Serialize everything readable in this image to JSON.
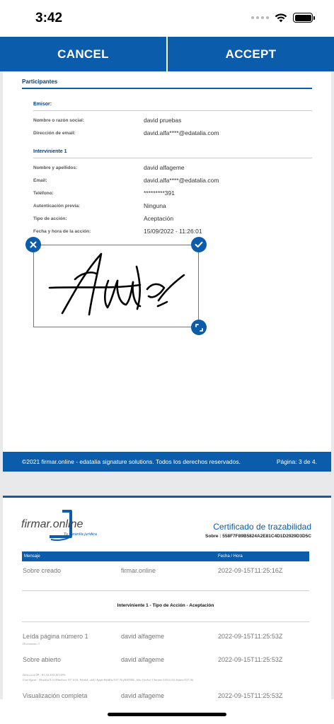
{
  "status": {
    "time": "3:42"
  },
  "actions": {
    "cancel": "CANCEL",
    "accept": "ACCEPT"
  },
  "page1": {
    "section_title": "Participantes",
    "emisor": {
      "title": "Emisor:",
      "rows": [
        {
          "k": "Nombre o razón social:",
          "v": "david pruebas"
        },
        {
          "k": "Dirección de email:",
          "v": "david.alfa****@edatalia.com"
        }
      ]
    },
    "interviniente": {
      "title": "Interviniente 1",
      "rows": [
        {
          "k": "Nombre y apellidos:",
          "v": "david alfageme"
        },
        {
          "k": "Email:",
          "v": "david.alfa****@edatalia.com"
        },
        {
          "k": "Teléfono:",
          "v": "*********391"
        },
        {
          "k": "Autenticación previa:",
          "v": "Ninguna"
        },
        {
          "k": "Tipo de acción:",
          "v": "Aceptación"
        },
        {
          "k": "Fecha y hora de la acción:",
          "v": "15/09/2022 - 11:26:01"
        }
      ]
    },
    "footer_left": "©2021 firmar.online - edatalia signature solutions. Todos los derechos reservados.",
    "footer_right": "Página: 3 de 4."
  },
  "page2": {
    "logo_text": "firmar.online",
    "logo_tagline": "Tu garantía jurídica",
    "cert_title": "Certificado de trazabilidad",
    "sobre": "Sobre : 558F7F89B5824A2E81C4D1D2929D3D5C",
    "headers": {
      "mensaje": "Mensaje",
      "fecha": "Fecha / Hora"
    },
    "rows": [
      {
        "c1": "Sobre creado",
        "c2": "firmar.online",
        "c3": "2022-09-15T11:25:16Z"
      },
      {
        "c1": "Leída página número 1",
        "c2": "david alfageme",
        "c3": "2022-09-15T11:25:53Z"
      },
      {
        "c1": "Sobre abierto",
        "c2": "david alfageme",
        "c3": "2022-09-15T11:25:53Z"
      },
      {
        "c1": "Visualización completa",
        "c2": "david alfageme",
        "c3": "2022-09-15T11:25:53Z"
      }
    ],
    "group_title": "Interviniente 1 - Tipo de Acción - Aceptación",
    "note_doc": "Documento 1",
    "note_ip": "Dirección IP : 83.54.154.18    GPS:",
    "note_ua": "UserAgent : Mozilla/5.0 (Windows NT 10.0; Win64; x64) AppleWebKit/537.36 (KHTML, like Gecko) Chrome/105.0.0.0 Safari/537.36"
  },
  "colors": {
    "brand": "#0b5cab"
  }
}
